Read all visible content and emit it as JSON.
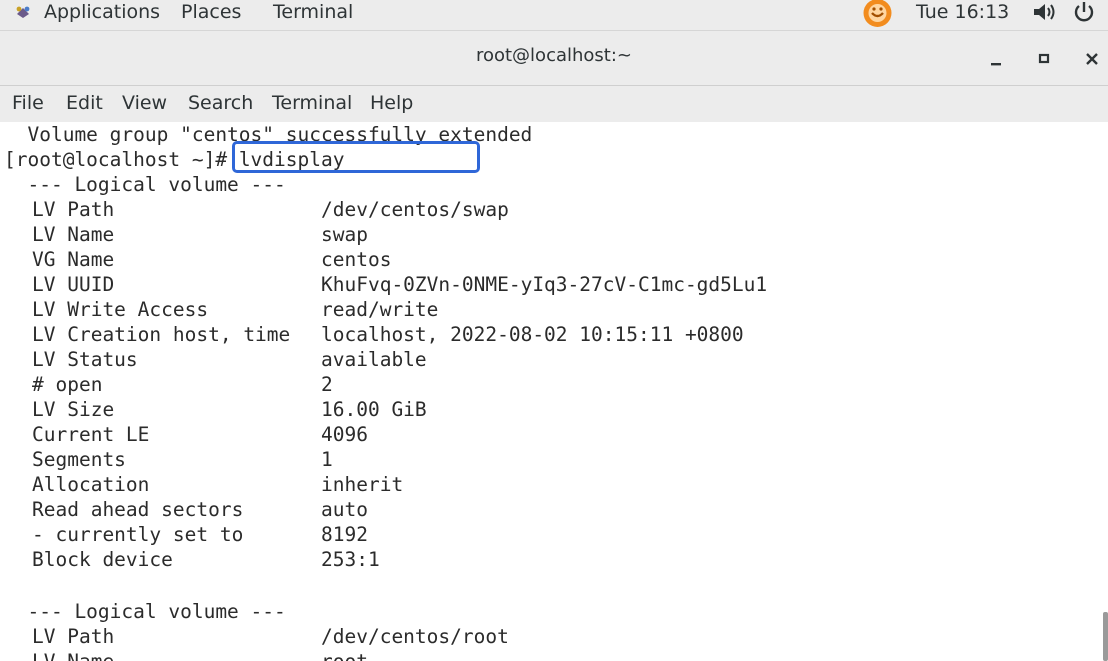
{
  "topbar": {
    "applications": "Applications",
    "places": "Places",
    "terminal": "Terminal",
    "clock": "Tue 16:13",
    "icons": [
      "app-menu-icon",
      "clock-icon",
      "volume-icon",
      "power-icon"
    ]
  },
  "window": {
    "title": "root@localhost:~",
    "buttons": [
      "minimize",
      "maximize",
      "close"
    ]
  },
  "menubar": {
    "items": [
      "File",
      "Edit",
      "View",
      "Search",
      "Terminal",
      "Help"
    ]
  },
  "terminal": {
    "line_extended": "  Volume group \"centos\" successfully extended",
    "prompt": "[root@localhost ~]",
    "prompt_symbol": "#",
    "command": " lvdisplay",
    "section_header": "  --- Logical volume ---",
    "volume1": [
      {
        "label": "LV Path",
        "value": "/dev/centos/swap"
      },
      {
        "label": "LV Name",
        "value": "swap"
      },
      {
        "label": "VG Name",
        "value": "centos"
      },
      {
        "label": "LV UUID",
        "value": "KhuFvq-0ZVn-0NME-yIq3-27cV-C1mc-gd5Lu1"
      },
      {
        "label": "LV Write Access",
        "value": "read/write"
      },
      {
        "label": "LV Creation host, time",
        "value": "localhost, 2022-08-02 10:15:11 +0800"
      },
      {
        "label": "LV Status",
        "value": "available"
      },
      {
        "label": "# open",
        "value": "2"
      },
      {
        "label": "LV Size",
        "value": "16.00 GiB"
      },
      {
        "label": "Current LE",
        "value": "4096"
      },
      {
        "label": "Segments",
        "value": "1"
      },
      {
        "label": "Allocation",
        "value": "inherit"
      },
      {
        "label": "Read ahead sectors",
        "value": "auto"
      },
      {
        "label": "- currently set to",
        "value": "8192"
      },
      {
        "label": "Block device",
        "value": "253:1"
      }
    ],
    "volume2": [
      {
        "label": "LV Path",
        "value": "/dev/centos/root"
      },
      {
        "label": "LV Name",
        "value": "root"
      }
    ]
  },
  "colors": {
    "highlight": "#2f67d8",
    "chrome": "#ececec",
    "text": "#2b2b2b"
  }
}
